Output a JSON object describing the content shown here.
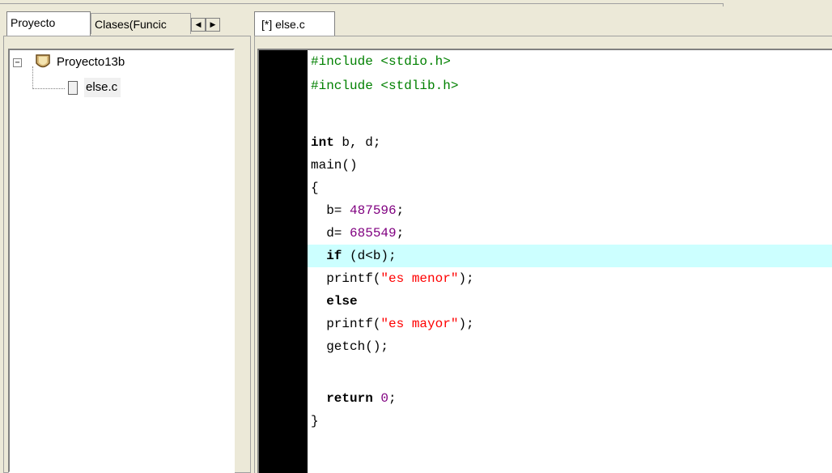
{
  "left_tabs": {
    "proyecto": "Proyecto",
    "clases": "Clases(Funcic",
    "scroll_left": "◀",
    "scroll_right": "▶"
  },
  "tree": {
    "project_expander": "−",
    "project_name": "Proyecto13b",
    "file_name": "else.c"
  },
  "editor_tab": "[*] else.c",
  "code": {
    "l1": "#include <stdio.h>",
    "l2": "#include <stdlib.h>",
    "l3": "",
    "l4_kw": "int",
    "l4_rest": " b, d;",
    "l5": "main()",
    "l6": "{",
    "l7_pre": "  b= ",
    "l7_num": "487596",
    "l7_post": ";",
    "l8_pre": "  d= ",
    "l8_num": "685549",
    "l8_post": ";",
    "l9_kw": "  if",
    "l9_rest": " (d<b);",
    "l10_pre": "  printf(",
    "l10_str": "\"es menor\"",
    "l10_post": ");",
    "l11_kw": "  else",
    "l12_pre": "  printf(",
    "l12_str": "\"es mayor\"",
    "l12_post": ");",
    "l13": "  getch();",
    "l14": "",
    "l15_kw": "  return",
    "l15_sp": " ",
    "l15_num": "0",
    "l15_post": ";",
    "l16": "}"
  },
  "colors": {
    "preprocessor": "#008000",
    "number": "#800080",
    "string": "#ff0000",
    "highlight": "#ccffff"
  }
}
